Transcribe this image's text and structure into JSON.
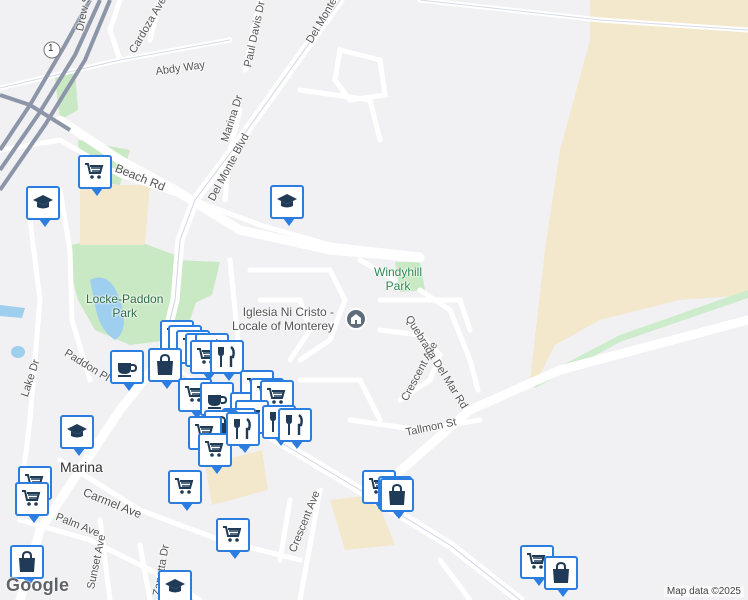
{
  "streets": {
    "drew": "Drew St",
    "cardoza": "Cardoza Ave",
    "del_monte_top": "Del Monte",
    "paul_davis": "Paul Davis Dr",
    "abdy": "Abdy Way",
    "marina_dr": "Marina Dr",
    "del_monte_blvd": "Del Monte Blvd",
    "beach": "Beach Rd",
    "paddon": "Paddon Pl",
    "lake": "Lake Dr",
    "crescent_ave_upper": "Crescent Ave",
    "quebrada": "Quebrada Del Mar Rd",
    "tallmon": "Tallmon St",
    "carmel": "Carmel Ave",
    "palm": "Palm Ave",
    "sunset": "Sunset Ave",
    "zanetta": "Zanetta Dr",
    "crescent_ave_lower": "Crescent Ave",
    "highway_shield": "1"
  },
  "places": {
    "windyhill_line1": "Windyhill",
    "windyhill_line2": "Park",
    "locke_line1": "Locke-Paddon",
    "locke_line2": "Park",
    "iglesia_line1": "Iglesia Ni Cristo -",
    "iglesia_line2": "Locale of Monterey",
    "marina": "Marina"
  },
  "footer": {
    "google": "Google",
    "attribution": "Map data ©2025"
  },
  "colors": {
    "pin_border": "#2b7de0",
    "icon_navy": "#1f3b57",
    "park_green": "#c9e9c4",
    "sand": "#f3e8cc",
    "highway": "#8d96a8"
  },
  "pins": [
    {
      "icon": "cart-icon"
    },
    {
      "icon": "school-icon"
    },
    {
      "icon": "school-icon"
    },
    {
      "icon": "cart-icon"
    },
    {
      "icon": "restaurant-icon"
    },
    {
      "icon": "cafe-icon"
    },
    {
      "icon": "bag-icon"
    },
    {
      "icon": "restaurant-icon"
    },
    {
      "icon": "cart-icon"
    },
    {
      "icon": "cafe-icon"
    },
    {
      "icon": "restaurant-icon"
    },
    {
      "icon": "restaurant-icon"
    },
    {
      "icon": "cart-icon"
    },
    {
      "icon": "bag-icon"
    },
    {
      "icon": "school-icon"
    },
    {
      "icon": "cart-icon"
    },
    {
      "icon": "cart-icon"
    },
    {
      "icon": "cart-icon"
    },
    {
      "icon": "cart-icon"
    },
    {
      "icon": "bag-icon"
    },
    {
      "icon": "cart-icon"
    },
    {
      "icon": "bag-icon"
    },
    {
      "icon": "school-icon"
    },
    {
      "icon": "bag-icon"
    }
  ]
}
